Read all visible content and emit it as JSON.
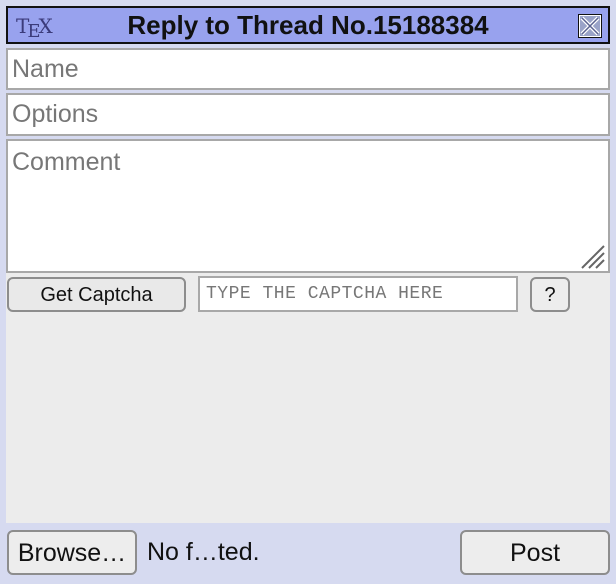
{
  "window": {
    "title": "Reply to Thread No.15188384",
    "tex_button": {
      "t": "T",
      "e": "E",
      "x": "X"
    },
    "close_icon": "close-x-icon",
    "colors": {
      "titlebar": "#98a2ee",
      "background": "#d6daf0",
      "captcha_area": "#ececec"
    }
  },
  "form": {
    "name_placeholder": "Name",
    "name_value": "",
    "options_placeholder": "Options",
    "options_value": "",
    "comment_placeholder": "Comment",
    "comment_value": ""
  },
  "captcha": {
    "get_label": "Get Captcha",
    "input_placeholder": "TYPE THE CAPTCHA HERE",
    "help_label": "?"
  },
  "footer": {
    "browse_label": "Browse…",
    "file_status": "No f…ted.",
    "post_label": "Post"
  }
}
